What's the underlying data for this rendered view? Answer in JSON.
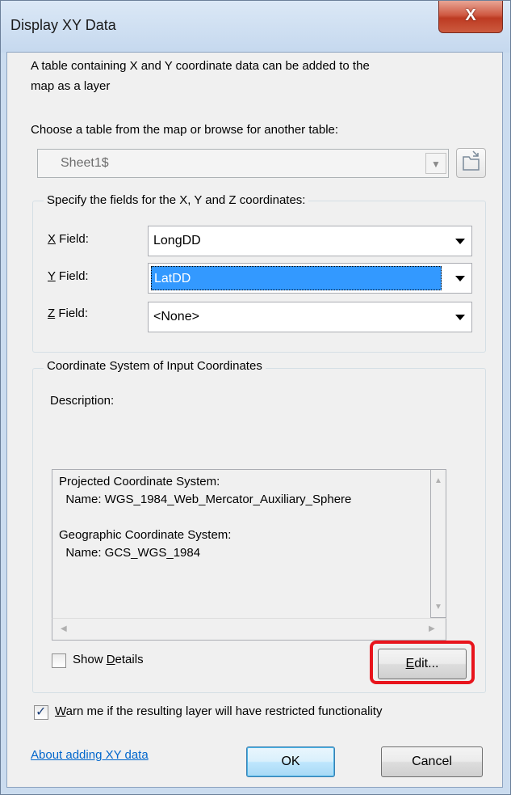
{
  "window": {
    "title": "Display XY Data",
    "close_glyph": "X"
  },
  "intro_text": {
    "line1": "A table containing X and Y coordinate data can be added to the",
    "line2": "map as a layer"
  },
  "table": {
    "prompt": "Choose a table from the map or browse for another table:",
    "selected": "Sheet1$",
    "browse_icon": "open-folder-icon"
  },
  "fields_group": {
    "label": "Specify the fields for the X, Y and Z coordinates:",
    "x": {
      "accel": "X",
      "rest": " Field:",
      "value": "LongDD"
    },
    "y": {
      "accel": "Y",
      "rest": " Field:",
      "value": "LatDD"
    },
    "z": {
      "accel": "Z",
      "rest": " Field:",
      "value": "<None>"
    }
  },
  "coord_group": {
    "label": "Coordinate System of Input Coordinates",
    "description_label": "Description:",
    "description_lines": {
      "l1": "Projected Coordinate System:",
      "l2": "  Name: WGS_1984_Web_Mercator_Auxiliary_Sphere",
      "l3": "",
      "l4": "Geographic Coordinate System:",
      "l5": "  Name: GCS_WGS_1984"
    },
    "show_details": {
      "pre": "Show ",
      "accel": "D",
      "post": "etails",
      "checked": false
    },
    "edit_button": {
      "accel": "E",
      "post": "dit..."
    }
  },
  "warn_checkbox": {
    "accel": "W",
    "post": "arn me if the resulting layer will have restricted functionality",
    "checked": true
  },
  "footer": {
    "about_link": "About adding XY data",
    "ok_label": "OK",
    "cancel_label": "Cancel"
  },
  "colors": {
    "highlight": "#e8141c",
    "selection": "#3399ff",
    "link": "#0066cc"
  }
}
